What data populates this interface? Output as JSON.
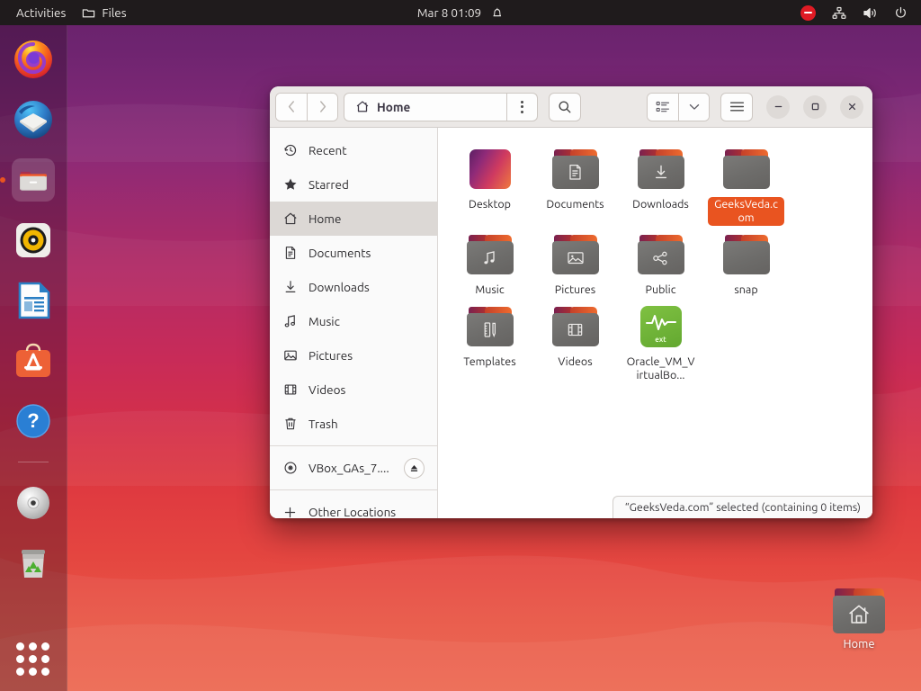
{
  "topbar": {
    "activities": "Activities",
    "app_name": "Files",
    "app_icon": "folder-icon",
    "clock": "Mar 8  01:09",
    "bell_icon": "notification-bell-icon",
    "tray": [
      {
        "name": "do-not-disturb-icon",
        "label": "Do Not Disturb"
      },
      {
        "name": "network-icon",
        "label": "Network"
      },
      {
        "name": "volume-icon",
        "label": "Volume"
      },
      {
        "name": "power-icon",
        "label": "Power"
      }
    ]
  },
  "dock": {
    "items": [
      {
        "name": "firefox",
        "label": "Firefox",
        "active": false
      },
      {
        "name": "thunderbird",
        "label": "Thunderbird",
        "active": false
      },
      {
        "name": "files",
        "label": "Files",
        "active": true
      },
      {
        "name": "rhythmbox",
        "label": "Rhythmbox",
        "active": false
      },
      {
        "name": "libreoffice-writer",
        "label": "LibreOffice Writer",
        "active": false
      },
      {
        "name": "ubuntu-software",
        "label": "Ubuntu Software",
        "active": false
      },
      {
        "name": "help",
        "label": "Help",
        "active": false
      },
      {
        "name": "cd-drive",
        "label": "VBox_GAs_7.0.6",
        "active": false
      },
      {
        "name": "trash",
        "label": "Trash",
        "active": false
      }
    ],
    "show_apps_label": "Show Applications"
  },
  "window": {
    "title": "Home",
    "nav": {
      "back": "Back",
      "forward": "Forward"
    },
    "path_icon": "home-icon",
    "path_label": "Home",
    "path_menu_label": "Path options",
    "search_label": "Search",
    "view_label": "View options",
    "view_chevron": "chevron-down-icon",
    "menu_label": "Main menu",
    "controls": {
      "minimize": "–",
      "maximize": "□",
      "close": "×"
    }
  },
  "sidebar": {
    "items": [
      {
        "label": "Recent",
        "icon": "clock-icon",
        "selected": false
      },
      {
        "label": "Starred",
        "icon": "star-icon",
        "selected": false
      },
      {
        "label": "Home",
        "icon": "home-icon",
        "selected": true
      },
      {
        "label": "Documents",
        "icon": "document-icon",
        "selected": false
      },
      {
        "label": "Downloads",
        "icon": "download-icon",
        "selected": false
      },
      {
        "label": "Music",
        "icon": "music-note-icon",
        "selected": false
      },
      {
        "label": "Pictures",
        "icon": "image-icon",
        "selected": false
      },
      {
        "label": "Videos",
        "icon": "film-icon",
        "selected": false
      },
      {
        "label": "Trash",
        "icon": "trash-icon",
        "selected": false
      }
    ],
    "device": {
      "label": "VBox_GAs_7....",
      "icon": "disc-icon",
      "eject": "eject-icon"
    },
    "other_locations": {
      "label": "Other Locations",
      "icon": "plus-icon"
    }
  },
  "files": [
    {
      "name": "Desktop",
      "type": "desktop-thumb",
      "emblem": "none",
      "selected": false
    },
    {
      "name": "Documents",
      "type": "folder",
      "emblem": "document",
      "selected": false
    },
    {
      "name": "Downloads",
      "type": "folder",
      "emblem": "download",
      "selected": false
    },
    {
      "name": "GeeksVeda.com",
      "type": "folder",
      "emblem": "none",
      "selected": true
    },
    {
      "name": "Music",
      "type": "folder",
      "emblem": "music",
      "selected": false
    },
    {
      "name": "Pictures",
      "type": "folder",
      "emblem": "image",
      "selected": false
    },
    {
      "name": "Public",
      "type": "folder",
      "emblem": "share",
      "selected": false
    },
    {
      "name": "snap",
      "type": "folder",
      "emblem": "none",
      "selected": false
    },
    {
      "name": "Templates",
      "type": "folder",
      "emblem": "templates",
      "selected": false
    },
    {
      "name": "Videos",
      "type": "folder",
      "emblem": "film",
      "selected": false
    },
    {
      "name": "Oracle_VM_VirtualBo...",
      "type": "ext",
      "emblem": "ext",
      "selected": false
    }
  ],
  "status": "“GeeksVeda.com” selected  (containing 0 items)",
  "desktop_icons": [
    {
      "label": "Home",
      "icon": "folder-home-icon"
    }
  ],
  "colors": {
    "accent": "#E95420",
    "topbar_bg": "#1f1b1c",
    "header_bg": "#ebe8e6",
    "sidebar_bg": "#fafafa",
    "sidebar_selected": "#dcd8d5",
    "folder_body": "#6d6c6a",
    "ext_green": "#7fc142"
  }
}
